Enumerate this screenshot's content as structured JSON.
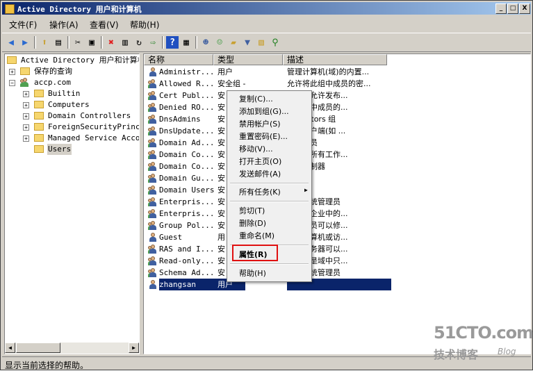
{
  "window": {
    "title": "Active Directory 用户和计算机",
    "buttons": [
      "_",
      "□",
      "X"
    ]
  },
  "menubar": [
    "文件(F)",
    "操作(A)",
    "查看(V)",
    "帮助(H)"
  ],
  "toolbar": [
    "back-icon",
    "forward-icon",
    "up-folder-icon",
    "show-tree-icon",
    "cut-icon",
    "copy-icon",
    "delete-icon",
    "properties-icon",
    "refresh-icon",
    "export-icon",
    "help-icon",
    "console-icon",
    "new-user-icon",
    "new-group-icon",
    "filter-icon",
    "add-to-group-icon",
    "find-icon"
  ],
  "tree": {
    "root": "Active Directory 用户和计算机",
    "saved_queries": "保存的查询",
    "domain": "accp.com",
    "children": [
      "Builtin",
      "Computers",
      "Domain Controllers",
      "ForeignSecurityPrincip",
      "Managed Service Accour",
      "Users"
    ]
  },
  "columns": [
    "名称",
    "类型",
    "描述"
  ],
  "rows": [
    {
      "name": "Administr...",
      "type": "用户",
      "desc": "管理计算机(域)的内置...",
      "icon": "user"
    },
    {
      "name": "Allowed R...",
      "type": "安全组 - 本...",
      "desc": "允许将此组中成员的密...",
      "icon": "group"
    },
    {
      "name": "Cert Publ...",
      "type": "安",
      "desc": "成员被允许发布...",
      "icon": "group"
    },
    {
      "name": "Denied RO...",
      "type": "安",
      "desc": "将此组中成员的...",
      "icon": "group"
    },
    {
      "name": "DnsAdmins",
      "type": "安",
      "desc": "inistrators 组",
      "icon": "group"
    },
    {
      "name": "DnsUpdate...",
      "type": "安",
      "desc": "其他客户端(如 ...",
      "icon": "group"
    },
    {
      "name": "Domain Ad...",
      "type": "安",
      "desc": "域管理员",
      "icon": "group"
    },
    {
      "name": "Domain Co...",
      "type": "安",
      "desc": "域中的所有工作...",
      "icon": "group"
    },
    {
      "name": "Domain Co...",
      "type": "安",
      "desc": "有域控制器",
      "icon": "group"
    },
    {
      "name": "Domain Gu...",
      "type": "安",
      "desc": "有来宾",
      "icon": "group"
    },
    {
      "name": "Domain Users",
      "type": "安",
      "desc": "用户",
      "icon": "group"
    },
    {
      "name": "Enterpris...",
      "type": "安",
      "desc": "指定系统管理员",
      "icon": "group"
    },
    {
      "name": "Enterpris...",
      "type": "安",
      "desc": "成员是企业中的...",
      "icon": "group"
    },
    {
      "name": "Group Pol...",
      "type": "安",
      "desc": "中的成员可以修...",
      "icon": "group"
    },
    {
      "name": "Guest",
      "type": "用",
      "desc": "访问计算机或访...",
      "icon": "user"
    },
    {
      "name": "RAS and I...",
      "type": "安",
      "desc": "中的服务器可以...",
      "icon": "group"
    },
    {
      "name": "Read-only...",
      "type": "安",
      "desc": "的成员是域中只...",
      "icon": "group"
    },
    {
      "name": "Schema Ad...",
      "type": "安",
      "desc": "指定系统管理员",
      "icon": "group"
    },
    {
      "name": "zhangsan",
      "type": "用户",
      "desc": "",
      "icon": "user",
      "selected": true
    }
  ],
  "context_menu": {
    "items": [
      "复制(C)...",
      "添加到组(G)...",
      "禁用帐户(S)",
      "重置密码(E)...",
      "移动(V)...",
      "打开主页(O)",
      "发送邮件(A)"
    ],
    "all_tasks": "所有任务(K)",
    "edit_items": [
      "剪切(T)",
      "删除(D)",
      "重命名(M)"
    ],
    "properties": "属性(R)",
    "help": "帮助(H)"
  },
  "statusbar": "显示当前选择的帮助。",
  "watermark": {
    "line1": "51CTO.com",
    "line2": "技术博客",
    "line3": "Blog"
  }
}
